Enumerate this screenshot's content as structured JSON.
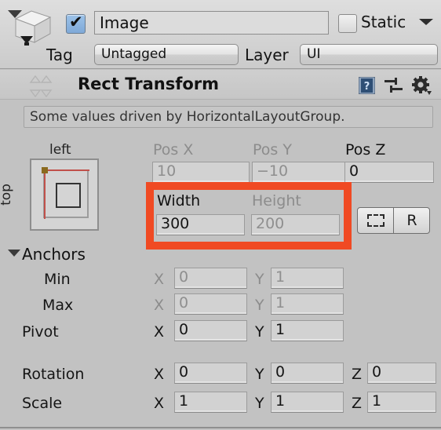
{
  "header": {
    "object_icon": "cube-icon",
    "active_checkbox_checked": true,
    "name_value": "Image",
    "static_label": "Static",
    "static_checked": false,
    "tag_label": "Tag",
    "tag_value": "Untagged",
    "layer_label": "Layer",
    "layer_value": "UI"
  },
  "component": {
    "title": "Rect Transform",
    "expanded": true,
    "icons": {
      "help": "help-book-icon",
      "preset": "preset-sliders-icon",
      "settings": "gear-icon"
    },
    "info_message": "Some values driven by HorizontalLayoutGroup."
  },
  "anchor_preset": {
    "top_label": "left",
    "side_label": "top"
  },
  "position_row": {
    "pos_x": {
      "label": "Pos X",
      "value": "10",
      "dimmed": true
    },
    "pos_y": {
      "label": "Pos Y",
      "value": "−10",
      "dimmed": true
    },
    "pos_z": {
      "label": "Pos Z",
      "value": "0",
      "dimmed": false
    }
  },
  "size_row": {
    "width": {
      "label": "Width",
      "value": "300",
      "dimmed": false
    },
    "height": {
      "label": "Height",
      "value": "200",
      "dimmed": true
    },
    "blueprint_button": "blueprint-mode-icon",
    "raw_button": "R"
  },
  "anchors": {
    "section_label": "Anchors",
    "min": {
      "label": "Min",
      "x_axis": "X",
      "x": "0",
      "y_axis": "Y",
      "y": "1",
      "dimmed": true
    },
    "max": {
      "label": "Max",
      "x_axis": "X",
      "x": "0",
      "y_axis": "Y",
      "y": "1",
      "dimmed": true
    }
  },
  "pivot": {
    "label": "Pivot",
    "x_axis": "X",
    "x": "0",
    "y_axis": "Y",
    "y": "1"
  },
  "rotation": {
    "label": "Rotation",
    "x_axis": "X",
    "x": "0",
    "y_axis": "Y",
    "y": "0",
    "z_axis": "Z",
    "z": "0"
  },
  "scale": {
    "label": "Scale",
    "x_axis": "X",
    "x": "1",
    "y_axis": "Y",
    "y": "1",
    "z_axis": "Z",
    "z": "1"
  },
  "annotation": {
    "highlight_color": "#f04a23",
    "highlight_target": "width-height-row"
  },
  "colors": {
    "background": "#c2c2c2",
    "header_background": "#d6d6d6",
    "field_background": "#d2d2d2",
    "dim_text": "#8c8c8c",
    "text": "#151515",
    "anchor_line": "#c0504a",
    "anchor_handle": "#8a6a1e"
  }
}
